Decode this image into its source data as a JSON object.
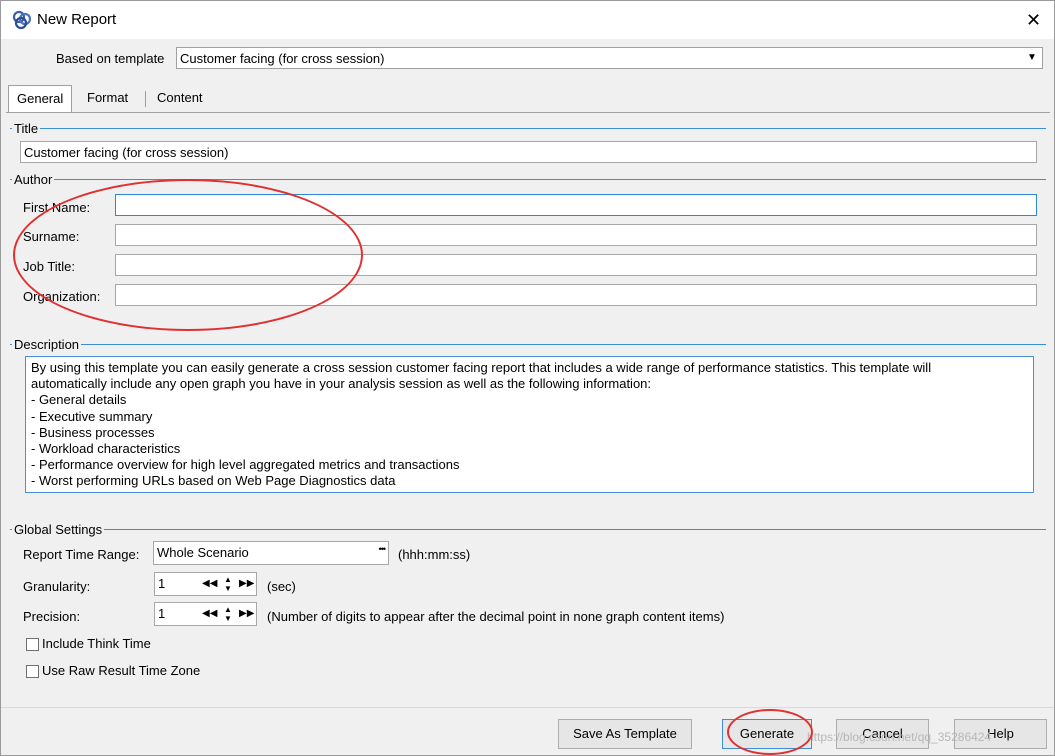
{
  "window": {
    "title": "New Report",
    "close_icon": "close-icon"
  },
  "template": {
    "label": "Based on template",
    "value": "Customer facing (for cross session)"
  },
  "tabs": [
    {
      "label": "General",
      "active": true
    },
    {
      "label": "Format",
      "active": false
    },
    {
      "label": "Content",
      "active": false
    }
  ],
  "title_section": {
    "heading": "Title",
    "value": "Customer facing (for cross session)"
  },
  "author_section": {
    "heading": "Author",
    "first_name_label": "First Name:",
    "first_name_value": "",
    "surname_label": "Surname:",
    "surname_value": "",
    "job_title_label": "Job Title:",
    "job_title_value": "",
    "organization_label": "Organization:",
    "organization_value": ""
  },
  "description_section": {
    "heading": "Description",
    "lines": [
      "By using this template you can easily generate a cross session customer facing report that includes a wide range of performance statistics. This template will",
      "automatically include any open graph you have in your analysis session as well as the following information:",
      "- General details",
      "- Executive summary",
      "- Business processes",
      "- Workload characteristics",
      "- Performance overview for high level aggregated metrics and transactions",
      "- Worst performing URLs based on Web Page Diagnostics data"
    ]
  },
  "global_settings": {
    "heading": "Global Settings",
    "time_range_label": "Report Time Range:",
    "time_range_value": "Whole Scenario",
    "time_range_button": "•••",
    "time_range_hint": "(hhh:mm:ss)",
    "granularity_label": "Granularity:",
    "granularity_value": "1",
    "granularity_hint": "(sec)",
    "precision_label": "Precision:",
    "precision_value": "1",
    "precision_hint": "(Number of digits to appear after the decimal point in none graph content items)",
    "include_think_time_label": "Include Think Time",
    "include_think_time_checked": false,
    "use_raw_tz_label": "Use Raw Result Time Zone",
    "use_raw_tz_checked": false
  },
  "buttons": {
    "save_template": "Save As Template",
    "generate": "Generate",
    "cancel": "Cancel",
    "help": "Help"
  },
  "watermark": "https://blog.csdn.net/qq_35286424",
  "colors": {
    "accent": "#3c8ed8",
    "annotation": "#e03030"
  }
}
